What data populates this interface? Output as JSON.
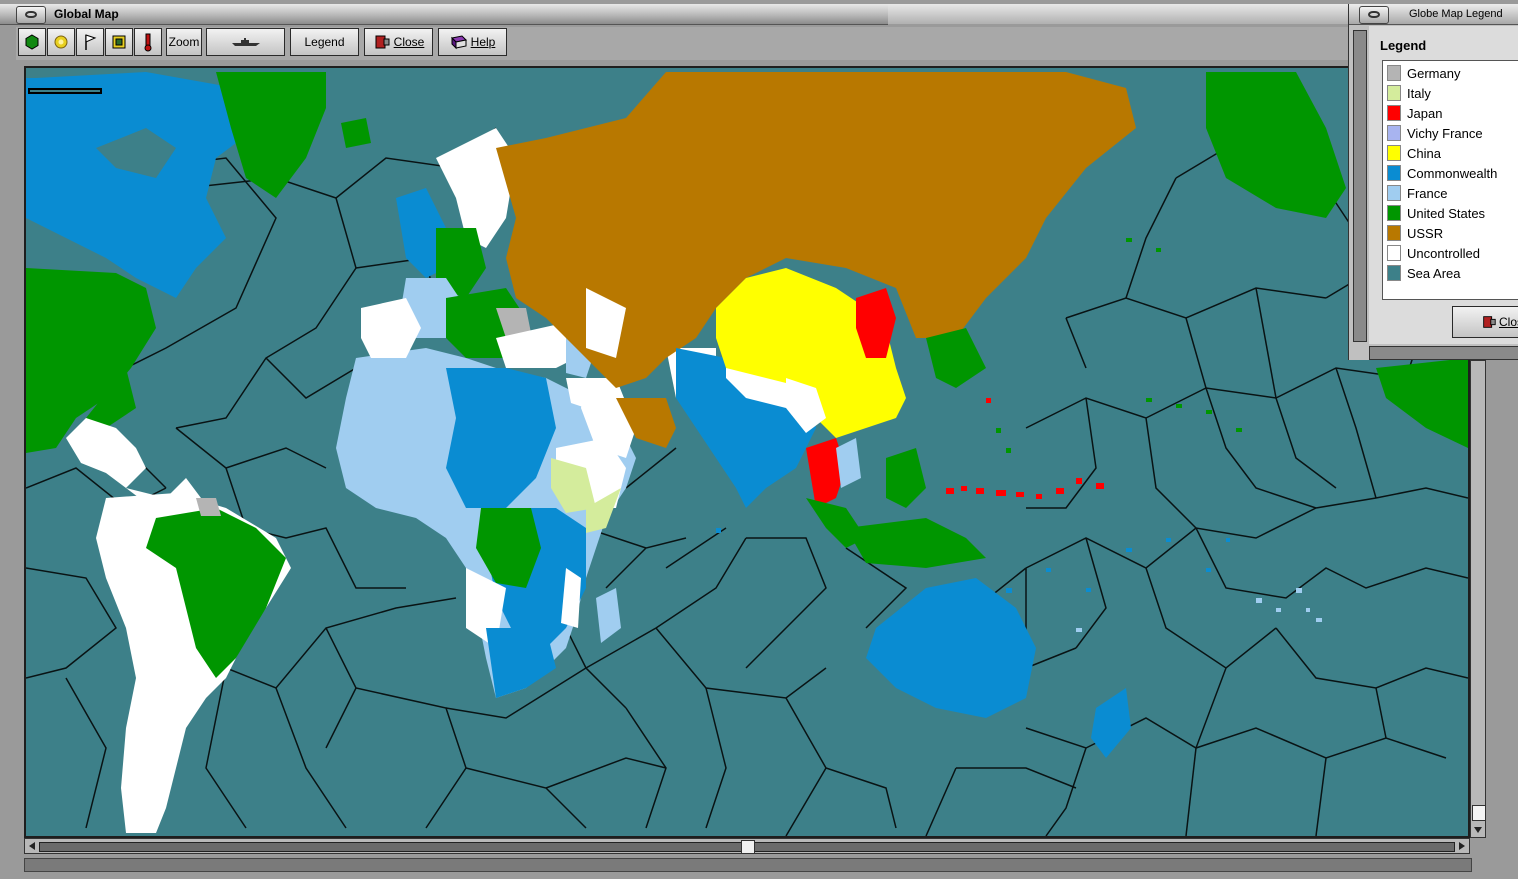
{
  "window": {
    "title": "Global Map"
  },
  "toolbar": {
    "zoom_label": "Zoom",
    "legend_label": "Legend",
    "close_label": "Close",
    "help_label": "Help"
  },
  "legend_window": {
    "title": "Globe Map Legend",
    "heading": "Legend",
    "close_label": "Clos",
    "items": [
      {
        "label": "Germany",
        "color": "#b4b4b4"
      },
      {
        "label": "Italy",
        "color": "#d4ec9c"
      },
      {
        "label": "Japan",
        "color": "#ff0000"
      },
      {
        "label": "Vichy France",
        "color": "#a8b4f0"
      },
      {
        "label": "China",
        "color": "#ffff00"
      },
      {
        "label": "Commonwealth",
        "color": "#0a8cd2"
      },
      {
        "label": "France",
        "color": "#a0cdf0"
      },
      {
        "label": "United States",
        "color": "#009600"
      },
      {
        "label": "USSR",
        "color": "#b87800"
      },
      {
        "label": "Uncontrolled",
        "color": "#ffffff"
      },
      {
        "label": "Sea Area",
        "color": "#3d8089"
      }
    ]
  },
  "map_colors": {
    "sea": "#3d8089",
    "commonwealth": "#0a8cd2",
    "united_states": "#009600",
    "ussr": "#b87800",
    "china": "#ffff00",
    "japan": "#ff0000",
    "france": "#a0cdf0",
    "italy": "#d4ec9c",
    "germany": "#b4b4b4",
    "uncontrolled": "#ffffff"
  }
}
